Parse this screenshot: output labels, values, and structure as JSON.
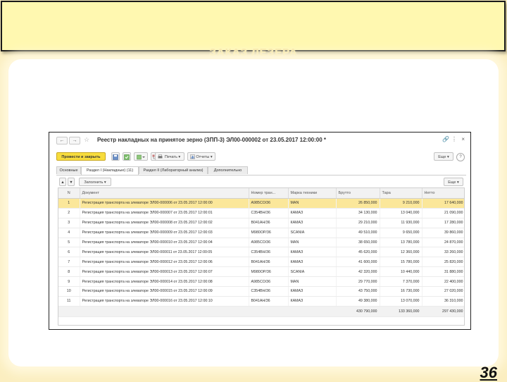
{
  "slide": {
    "subtitle": "ЗАКАЗ ЛЕЗЕРА",
    "page_number": "36"
  },
  "window": {
    "title": "Реестр накладных на принятое зерно (ЗПП-3) ЭЛ00-000002 от 23.05.2017 12:00:00 *",
    "back_icon": "←",
    "forward_icon": "→",
    "star_icon": "☆",
    "link_icon": "🔗",
    "menu_icon": "⋮",
    "close_icon": "×"
  },
  "toolbar": {
    "post_close_label": "Провести и закрыть",
    "print_label": "Печать",
    "reports_label": "Отчеты",
    "more_label": "Еще",
    "help_label": "?"
  },
  "tabs": [
    {
      "label": "Основные"
    },
    {
      "label": "Раздел I (Накладные) (11)"
    },
    {
      "label": "Раздел II (Лабораторный анализ)"
    },
    {
      "label": "Дополнительно"
    }
  ],
  "subtoolbar": {
    "fill_label": "Заполнить",
    "more_label": "Еще"
  },
  "table": {
    "columns": [
      "N",
      "Документ",
      "Номер тран...",
      "Марка техники",
      "Брутто",
      "Тара",
      "Нетто"
    ],
    "rows": [
      [
        "1",
        "Регистрация транспорта на элеваторе ЭЛ00-000006 от 23.05.2017 12:00:00",
        "А985СО/36",
        "MAN",
        "26 850,000",
        "9 210,000",
        "17 640,000"
      ],
      [
        "2",
        "Регистрация транспорта на элеваторе ЭЛ00-000007 от 23.05.2017 12:00:01",
        "С354ВН/36",
        "КАМАЗ",
        "34 130,000",
        "13 040,000",
        "21 090,000"
      ],
      [
        "3",
        "Регистрация транспорта на элеваторе ЭЛ00-000008 от 23.05.2017 12:00:02",
        "В041АН/36",
        "КАМАЗ",
        "29 210,000",
        "11 930,000",
        "17 280,000"
      ],
      [
        "4",
        "Регистрация транспорта на элеваторе ЭЛ00-000009 от 23.05.2017 12:00:03",
        "М980ОР/36",
        "SCANIA",
        "49 510,000",
        "9 650,000",
        "39 860,000"
      ],
      [
        "5",
        "Регистрация транспорта на элеваторе ЭЛ00-000010 от 23.05.2017 12:00:04",
        "А985СО/36",
        "MAN",
        "38 650,000",
        "13 780,000",
        "24 870,000"
      ],
      [
        "6",
        "Регистрация транспорта на элеваторе ЭЛ00-000011 от 23.05.2017 12:00:05",
        "С354ВН/36",
        "КАМАЗ",
        "45 620,000",
        "12 360,000",
        "33 260,000"
      ],
      [
        "7",
        "Регистрация транспорта на элеваторе ЭЛ00-000012 от 23.05.2017 12:00:06",
        "В041АН/36",
        "КАМАЗ",
        "41 600,000",
        "15 780,000",
        "25 820,000"
      ],
      [
        "8",
        "Регистрация транспорта на элеваторе ЭЛ00-000013 от 23.05.2017 12:00:07",
        "М980ОР/36",
        "SCANIA",
        "42 320,000",
        "10 440,000",
        "31 880,000"
      ],
      [
        "9",
        "Регистрация транспорта на элеваторе ЭЛ00-000014 от 23.05.2017 12:00:08",
        "А985СО/36",
        "MAN",
        "29 770,000",
        "7 370,000",
        "22 400,000"
      ],
      [
        "10",
        "Регистрация транспорта на элеваторе ЭЛ00-000015 от 23.05.2017 12:00:09",
        "С354ВН/36",
        "КАМАЗ",
        "43 750,000",
        "16 730,000",
        "27 020,000"
      ],
      [
        "11",
        "Регистрация транспорта на элеваторе ЭЛ00-000016 от 23.05.2017 12:00:10",
        "В041АН/36",
        "КАМАЗ",
        "49 380,000",
        "13 070,000",
        "36 310,000"
      ]
    ],
    "totals": [
      "430 790,000",
      "133 360,000",
      "297 430,000"
    ]
  },
  "colors": {
    "slide_background": "#fbeec0",
    "title_box": "#fff8b0",
    "primary_button": "#f7dc3c",
    "selected_row": "#fbe79a"
  }
}
